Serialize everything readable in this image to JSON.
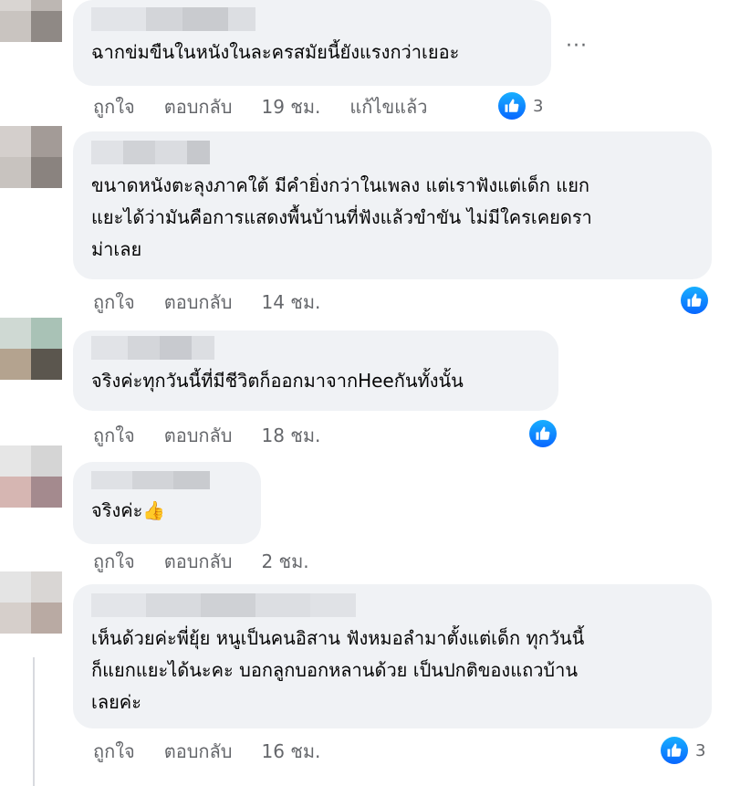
{
  "comments": [
    {
      "text": "ฉากข่มขืนในหนังในละครสมัยนี้ยังแรงกว่าเยอะ",
      "like_label": "ถูกใจ",
      "reply_label": "ตอบกลับ",
      "time": "19 ชม.",
      "edited": "แก้ไขแล้ว",
      "reaction_count": "3",
      "more_label": "···"
    },
    {
      "text": "ขนาดหนังตะลุงภาคใต้ มีคำยิ่งกว่าในเพลง แต่เราฟังแต่เด็ก แยก\nแยะได้ว่ามันคือการแสดงพื้นบ้านที่ฟังแล้วขำขัน ไม่มีใครเคยดรา\nม่าเลย",
      "like_label": "ถูกใจ",
      "reply_label": "ตอบกลับ",
      "time": "14 ชม."
    },
    {
      "text": "จริงค่ะทุกวันนี้ที่มีชีวิตก็ออกมาจากHeeกันทั้งนั้น",
      "like_label": "ถูกใจ",
      "reply_label": "ตอบกลับ",
      "time": "18 ชม."
    },
    {
      "text": "จริงค่ะ👍",
      "like_label": "ถูกใจ",
      "reply_label": "ตอบกลับ",
      "time": "2 ชม."
    },
    {
      "text": "เห็นด้วยค่ะพี่ยุ้ย หนูเป็นคนอิสาน ฟังหมอลำมาตั้งแต่เด็ก ทุกวันนี้\nก็แยกแยะได้นะคะ บอกลูกบอกหลานด้วย เป็นปกติของแถวบ้าน\nเลยค่ะ",
      "like_label": "ถูกใจ",
      "reply_label": "ตอบกลับ",
      "time": "16 ชม.",
      "reaction_count": "3"
    }
  ],
  "colors": {
    "bubble": "#f0f2f5",
    "meta_text": "#65676b",
    "like_blue": "#0866ff"
  },
  "icons": {
    "reaction": "thumbs-up-icon",
    "more": "more-horizontal-icon"
  }
}
